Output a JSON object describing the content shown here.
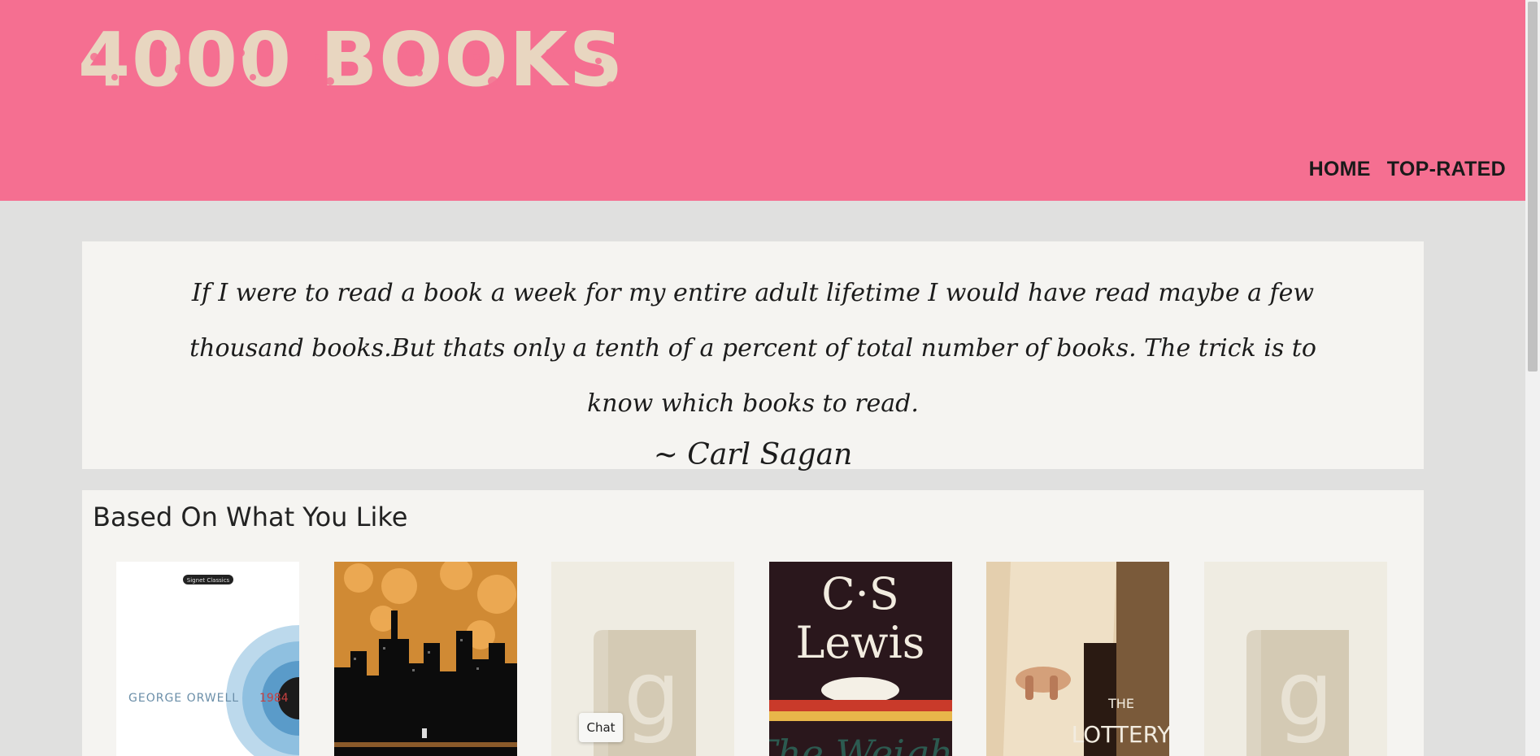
{
  "header": {
    "logo_text": "4000 BOOKS",
    "nav": [
      {
        "label": "HOME"
      },
      {
        "label": "TOP-RATED"
      }
    ]
  },
  "quote": {
    "text": "If I were to read a book a week for my entire adult lifetime I would have read maybe a few thousand books.But thats only a tenth of a percent of total number of books. The trick is to know which books to read.",
    "author": "~ Carl Sagan"
  },
  "recommendations": {
    "title": "Based On What You Like",
    "books": [
      {
        "cover": "cover-1984",
        "author_text": "GEORGE ORWELL",
        "title_text": "1984",
        "top_text": "Signet Classics"
      },
      {
        "cover": "cover-city-skyline",
        "author_text": "",
        "title_text": ""
      },
      {
        "cover": "cover-placeholder",
        "author_text": "",
        "title_text": ""
      },
      {
        "cover": "cover-cs-lewis",
        "author_text": "C·S Lewis",
        "title_text": "The Weight"
      },
      {
        "cover": "cover-lottery",
        "author_text": "",
        "title_text": "THE LOTTERY"
      },
      {
        "cover": "cover-placeholder",
        "author_text": "",
        "title_text": ""
      }
    ]
  },
  "chat": {
    "label": "Chat"
  },
  "colors": {
    "header_bg": "#f56f91",
    "logo": "#e8d6c0",
    "page_bg": "#e0e0df",
    "panel_bg": "#f5f4f1"
  }
}
